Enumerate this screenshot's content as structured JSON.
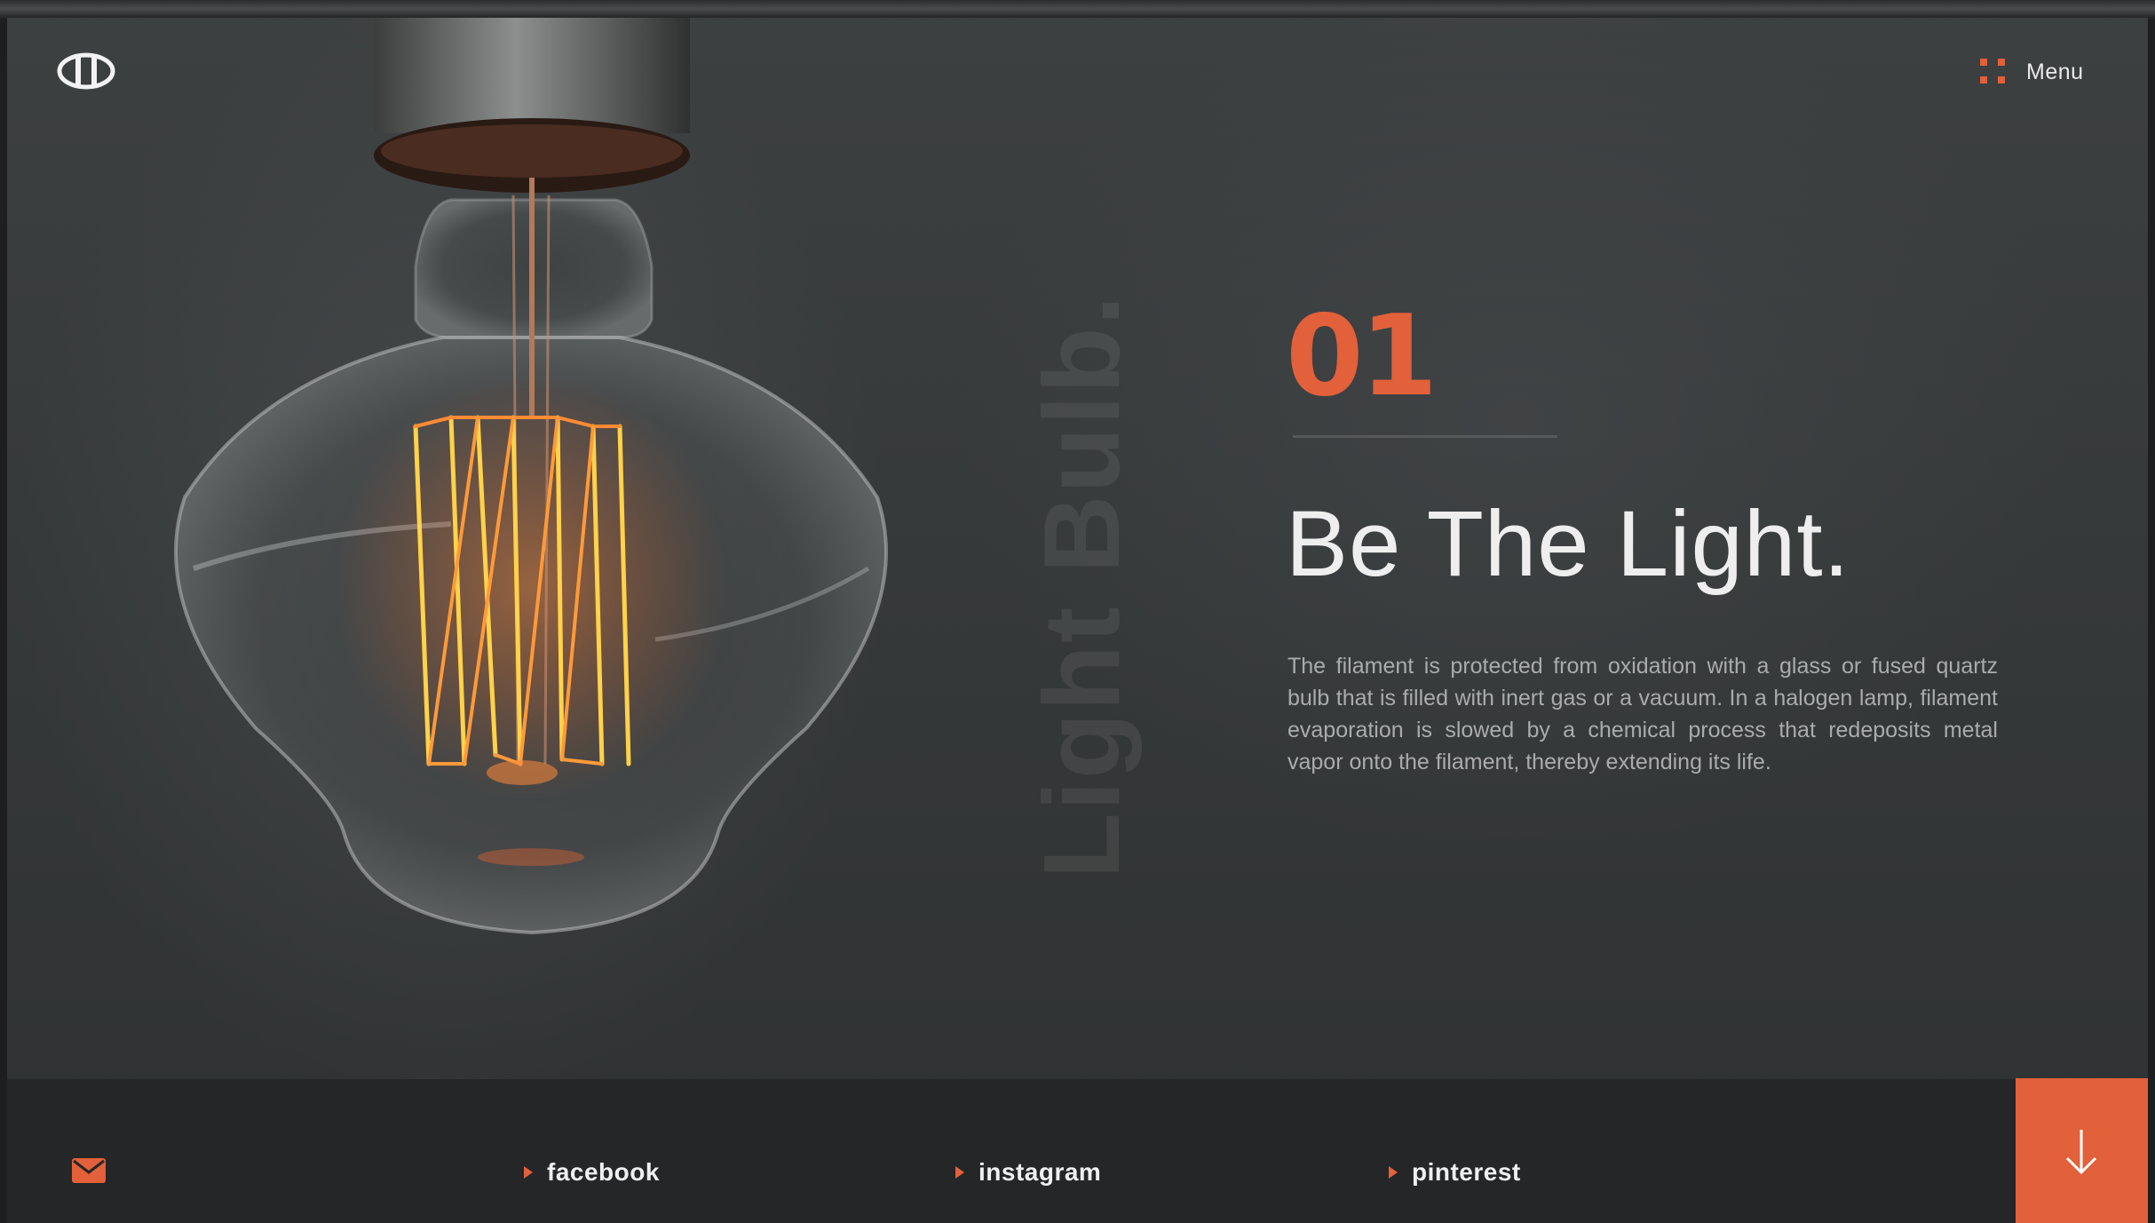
{
  "brand": {
    "logo_icon": "brand-logo-icon"
  },
  "nav": {
    "menu_label": "Menu",
    "menu_icon": "grid-dots-icon"
  },
  "hero": {
    "vertical_title": "Light Bulb.",
    "slide_number": "01",
    "headline": "Be The Light.",
    "body": "The filament is protected from oxidation with a glass or fused quartz bulb that is filled with inert gas or a vacuum. In a halogen lamp, filament evaporation is slowed by a chemical process that redeposits metal vapor onto the filament, thereby extending its life."
  },
  "footer": {
    "mail_icon": "envelope-icon",
    "social": [
      {
        "label": "facebook"
      },
      {
        "label": "instagram"
      },
      {
        "label": "pinterest"
      }
    ],
    "scroll_icon": "arrow-down-icon"
  },
  "colors": {
    "accent": "#e2603a",
    "background": "#36393a",
    "footer": "#242627",
    "text_light": "#eeeeee",
    "text_muted": "#a9abad"
  }
}
